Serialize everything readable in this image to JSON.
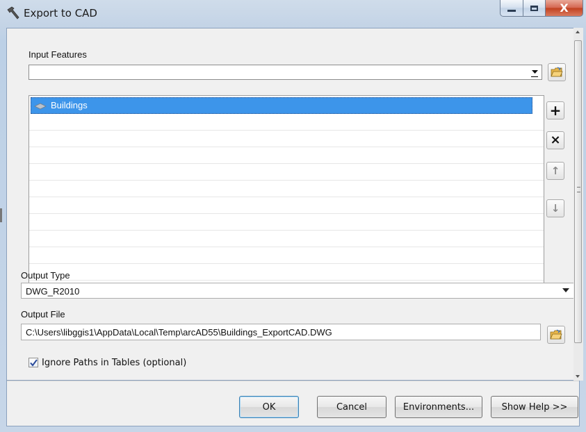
{
  "window": {
    "title": "Export to CAD",
    "minimize_label": "—",
    "maximize_label": "□",
    "close_label": "X"
  },
  "input_features": {
    "label": "Input Features",
    "value": "",
    "items": [
      {
        "label": "Buildings",
        "selected": true
      }
    ]
  },
  "list_buttons": {
    "add": "+",
    "remove": "×",
    "up": "↑",
    "down": "↓"
  },
  "output_type": {
    "label": "Output Type",
    "value": "DWG_R2010"
  },
  "output_file": {
    "label": "Output File",
    "value": "C:\\Users\\libggis1\\AppData\\Local\\Temp\\arcAD55\\Buildings_ExportCAD.DWG"
  },
  "ignore_paths": {
    "label": "Ignore Paths in Tables (optional)",
    "checked": true
  },
  "buttons": {
    "ok": "OK",
    "cancel": "Cancel",
    "environments": "Environments...",
    "show_help": "Show Help >>"
  },
  "colors": {
    "selection": "#3d95ea",
    "close_button": "#c1401f"
  }
}
